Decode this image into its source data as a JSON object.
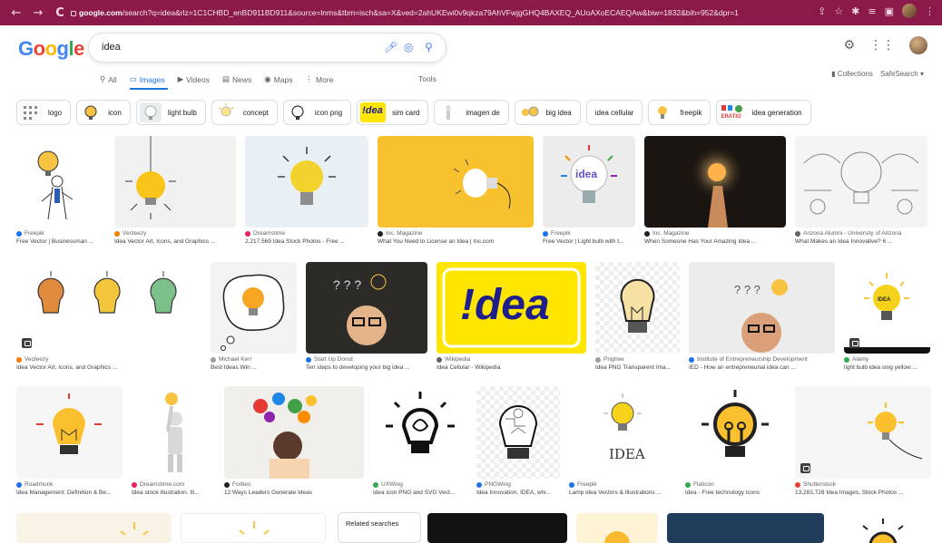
{
  "browser": {
    "url_domain": "google.com",
    "url_path": "/search?q=idea&rlz=1C1CHBD_enBD911BD911&source=lnms&tbm=isch&sa=X&ved=2ahUKEwi0v9qkza79AhVFwjgGHQ4BAXEQ_AUoAXoECAEQAw&biw=1832&bih=952&dpr=1",
    "nav_back": "←",
    "nav_forward": "→",
    "reload": "C"
  },
  "search": {
    "query": "idea"
  },
  "tabs": [
    {
      "label": "All",
      "icon": "search-icon"
    },
    {
      "label": "Images",
      "icon": "image-icon"
    },
    {
      "label": "Videos",
      "icon": "video-icon"
    },
    {
      "label": "News",
      "icon": "news-icon"
    },
    {
      "label": "Maps",
      "icon": "map-pin-icon"
    },
    {
      "label": "More",
      "icon": "more-vert-icon"
    }
  ],
  "tools_label": "Tools",
  "collections_label": "Collections",
  "safesearch_label": "SafeSearch",
  "chips": [
    {
      "label": "logo"
    },
    {
      "label": "icon"
    },
    {
      "label": "light bulb"
    },
    {
      "label": "concept"
    },
    {
      "label": "icon png"
    },
    {
      "label": "sim card"
    },
    {
      "label": "imagen de"
    },
    {
      "label": "big idea"
    },
    {
      "label": "idea cellular"
    },
    {
      "label": "freepik"
    },
    {
      "label": "idea generation"
    }
  ],
  "chip_text": {
    "sim_card_logo": "!dea",
    "generation_logo": "ERATIO"
  },
  "row1": [
    {
      "source": "Freepik",
      "caption": "Free Vector | Businessman ...",
      "fav": "#1a73e8"
    },
    {
      "source": "Vecteezy",
      "caption": "Idea Vector Art, Icons, and Graphics ...",
      "fav": "#f57c00"
    },
    {
      "source": "Dreamstime",
      "caption": "2,217,569 Idea Stock Photos - Free ...",
      "fav": "#e91e63"
    },
    {
      "source": "Inc. Magazine",
      "caption": "What You Need to License an Idea | Inc.com",
      "fav": "#202124"
    },
    {
      "source": "Freepik",
      "caption": "Free Vector | Light bulb with t...",
      "fav": "#1a73e8"
    },
    {
      "source": "Inc. Magazine",
      "caption": "When Someone Has Your Amazing Idea ...",
      "fav": "#202124"
    },
    {
      "source": "Arizona Alumni - University of Arizona",
      "caption": "What Makes an Idea Innovative? 6 ...",
      "fav": "#5f6368"
    }
  ],
  "row2": [
    {
      "source": "Vecteezy",
      "caption": "Idea Vector Art, Icons, and Graphics ...",
      "fav": "#f57c00"
    },
    {
      "source": "Michael Kerr",
      "caption": "Best Ideas Win ...",
      "fav": "#9aa0a6"
    },
    {
      "source": "Start Up Donut",
      "caption": "Ten steps to developing your big idea ...",
      "fav": "#1a73e8"
    },
    {
      "source": "Wikipedia",
      "caption": "Idea Cellular - Wikipedia",
      "fav": "#5f6368"
    },
    {
      "source": "Pngtree",
      "caption": "Idea PNG Transparent Ima...",
      "fav": "#9aa0a6"
    },
    {
      "source": "Institute of Entrepreneurship Development",
      "caption": "IED - How an entrepreneurial idea can ...",
      "fav": "#1a73e8"
    },
    {
      "source": "Alamy",
      "caption": "light bulb idea sing yellow ...",
      "fav": "#34a853"
    }
  ],
  "row2_text": {
    "idea_logo": "!dea",
    "idea_bulb_label": "IDEA"
  },
  "row3": [
    {
      "source": "Roadmunk",
      "caption": "Idea Management: Definition & Be...",
      "fav": "#1a73e8"
    },
    {
      "source": "Dreamstime.com",
      "caption": "Idea stock illustration. Ill...",
      "fav": "#e91e63"
    },
    {
      "source": "Forbes",
      "caption": "12 Ways Leaders Generate Ideas",
      "fav": "#202124"
    },
    {
      "source": "UXWing",
      "caption": "Idea icon PNG and SVG Vect...",
      "fav": "#34a853"
    },
    {
      "source": "PNGWing",
      "caption": "Idea Innovation, IDEA, whi...",
      "fav": "#1a73e8"
    },
    {
      "source": "Freepik",
      "caption": "Lamp idea Vectors & Illustrations ...",
      "fav": "#1a73e8"
    },
    {
      "source": "Flaticon",
      "caption": "Idea - Free technology icons",
      "fav": "#34a853"
    },
    {
      "source": "Shutterstock",
      "caption": "13,283,728 Idea Images, Stock Photos ...",
      "fav": "#ea4335"
    }
  ],
  "row3_text": {
    "lamp_label": "IDEA"
  },
  "related_searches_label": "Related searches"
}
